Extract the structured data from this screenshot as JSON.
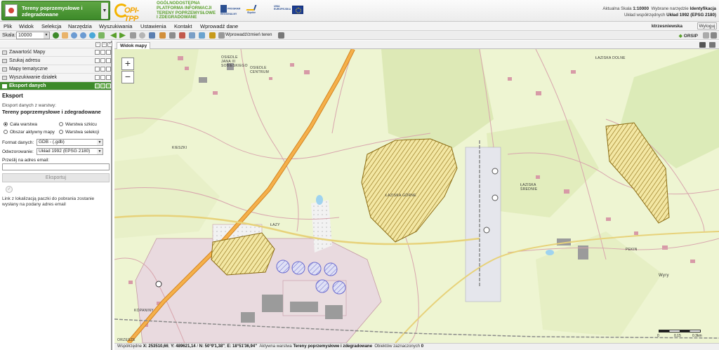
{
  "header": {
    "layer_select": "Tereny poprzemysłowe i zdegradowane",
    "logo_text": "OPI-TPP",
    "platform_lines": [
      "OGÓLNODOSTĘPNA",
      "PLATFORMA INFORMACJI",
      "TERENY POPRZEMYSŁOWE",
      "I ZDEGRADOWANE"
    ],
    "partners": [
      "PROGRAM REGIONALNY",
      "Śląskie",
      "UNIA EUROPEJSKA"
    ],
    "scale_label": "Aktualna Skala",
    "scale_value": "1:10000",
    "tool_label": "Wybrane narzędzie",
    "tool_value": "Identyfikacja",
    "crs_label": "Układ współrzędnych",
    "crs_value": "Układ 1992 (EPSG 2180)"
  },
  "menu": [
    "Plik",
    "Widok",
    "Selekcja",
    "Narzędzia",
    "Wyszukiwania",
    "Ustawienia",
    "Kontakt",
    "Wprowadź dane"
  ],
  "user": {
    "name": "ktrzesniewska",
    "logout": "Wyloguj"
  },
  "toolbar": {
    "scale_label": "Skala:",
    "scale_value": "10000",
    "coord_button": "Wprowadź/zmień teren",
    "orsip": "ORSIP",
    "icons": [
      "info-icon",
      "pan-icon",
      "zoom-in-icon",
      "zoom-out-icon",
      "globe-icon",
      "zoom-extent-icon",
      "back-icon",
      "forward-icon",
      "select-icon",
      "measure-icon",
      "ruler-icon",
      "draw-icon",
      "print-icon"
    ]
  },
  "sidebar": {
    "panels": [
      "Zawartość Mapy",
      "Szukaj adresu",
      "Mapy tematyczne",
      "Wyszukiwanie działek",
      "Eksport danych"
    ],
    "export": {
      "title": "Eksport",
      "sub": "Eksport danych z warstwy:",
      "layer": "Tereny poprzemysłowe i zdegradowane",
      "options": [
        "Cała warstwa",
        "Warstwa szkicu",
        "Obszar aktywny mapy",
        "Warstwa selekcji"
      ],
      "selected_option": "Cała warstwa",
      "format_label": "Format danych:",
      "format_value": "GDB - (.gdb)",
      "crs_label": "Odwzorowanie:",
      "crs_value": "Układ 1992 (EPSG 2180)",
      "email_label": "Prześlij na adres email:",
      "email_value": "",
      "export_button": "Eksportuj",
      "note": "Link z lokalizacją paczki do pobrania zostanie wysłany na podany adres email"
    }
  },
  "map": {
    "tab": "Widok mapy",
    "labels": [
      "OSIEDLE JANA III SOBIESKIEGO",
      "OSIEDLE CENTRUM",
      "KIESZKI",
      "ŁAZISKA GÓRNE",
      "ŁAZISKA ŚREDNIE",
      "ŁAZISKA DOLNE",
      "ŁAZY",
      "PEKIN",
      "KOPANINY",
      "ORZESZE",
      "Wyry"
    ],
    "scale_ticks": [
      "0",
      "0.15",
      "0.3km"
    ]
  },
  "status": {
    "coords_label": "Współrzędne",
    "x": "X: 253510,66",
    "y": "Y: 489621,14",
    "n": "N: 50°9'1,38\"",
    "e": "E: 18°51'36,94\"",
    "active_label": "Aktywna warstwa",
    "active_value": "Tereny poprzemysłowe i zdegradowane",
    "selected_label": "Obiektów zaznaczonych",
    "selected_value": "0"
  },
  "colors": {
    "accent_green": "#3d8a2a",
    "hatch": "#c79a1a",
    "road": "#f2a33a"
  }
}
